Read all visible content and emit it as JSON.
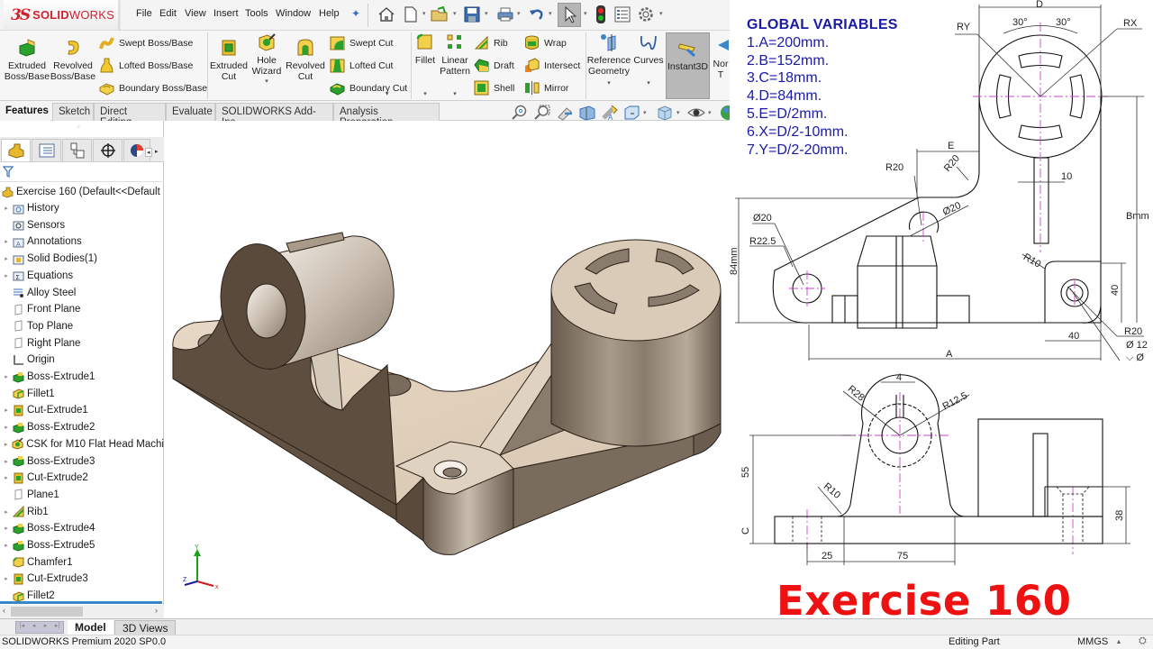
{
  "app": {
    "logo_prefix": "3S",
    "logo_bold": "SOLID",
    "logo_light": "WORKS"
  },
  "menu": [
    "File",
    "Edit",
    "View",
    "Insert",
    "Tools",
    "Window",
    "Help"
  ],
  "quick_access": [
    "home-icon",
    "new-document-icon",
    "open-icon",
    "save-icon",
    "print-icon",
    "undo-icon",
    "select-icon",
    "rebuild-icon",
    "file-properties-icon",
    "options-icon"
  ],
  "ribbon": {
    "extruded_boss": "Extruded\nBoss/Base",
    "revolved_boss": "Revolved\nBoss/Base",
    "swept_boss": "Swept Boss/Base",
    "lofted_boss": "Lofted Boss/Base",
    "boundary_boss": "Boundary Boss/Base",
    "extruded_cut": "Extruded\nCut",
    "hole_wizard": "Hole\nWizard",
    "revolved_cut": "Revolved\nCut",
    "swept_cut": "Swept Cut",
    "lofted_cut": "Lofted Cut",
    "boundary_cut": "Boundary Cut",
    "fillet": "Fillet",
    "linear_pattern": "Linear\nPattern",
    "rib": "Rib",
    "draft": "Draft",
    "shell": "Shell",
    "wrap": "Wrap",
    "intersect": "Intersect",
    "mirror": "Mirror",
    "reference_geometry": "Reference\nGeometry",
    "curves": "Curves",
    "instant3d": "Instant3D",
    "normal_to": "Nor\nT"
  },
  "command_tabs": [
    "Features",
    "Sketch",
    "Direct Editing",
    "Evaluate",
    "SOLIDWORKS Add-Ins",
    "Analysis Preparation"
  ],
  "active_command_tab": "Features",
  "feature_tree": {
    "root": "Exercise 160  (Default<<Default",
    "items": [
      {
        "label": "History",
        "icon": "history-folder-icon",
        "expandable": true
      },
      {
        "label": "Sensors",
        "icon": "sensors-folder-icon",
        "expandable": false
      },
      {
        "label": "Annotations",
        "icon": "annotations-folder-icon",
        "expandable": true
      },
      {
        "label": "Solid Bodies(1)",
        "icon": "solid-bodies-folder-icon",
        "expandable": true
      },
      {
        "label": "Equations",
        "icon": "equations-folder-icon",
        "expandable": true
      },
      {
        "label": "Alloy Steel",
        "icon": "material-icon",
        "expandable": false
      },
      {
        "label": "Front Plane",
        "icon": "plane-icon",
        "expandable": false
      },
      {
        "label": "Top Plane",
        "icon": "plane-icon",
        "expandable": false
      },
      {
        "label": "Right Plane",
        "icon": "plane-icon",
        "expandable": false
      },
      {
        "label": "Origin",
        "icon": "origin-icon",
        "expandable": false
      },
      {
        "label": "Boss-Extrude1",
        "icon": "boss-extrude-icon",
        "expandable": true
      },
      {
        "label": "Fillet1",
        "icon": "fillet-icon",
        "expandable": false
      },
      {
        "label": "Cut-Extrude1",
        "icon": "cut-extrude-icon",
        "expandable": true
      },
      {
        "label": "Boss-Extrude2",
        "icon": "boss-extrude-icon",
        "expandable": true
      },
      {
        "label": "CSK for M10 Flat Head Machi",
        "icon": "hole-wizard-icon",
        "expandable": true
      },
      {
        "label": "Boss-Extrude3",
        "icon": "boss-extrude-icon",
        "expandable": true
      },
      {
        "label": "Cut-Extrude2",
        "icon": "cut-extrude-icon",
        "expandable": true
      },
      {
        "label": "Plane1",
        "icon": "plane-icon",
        "expandable": false
      },
      {
        "label": "Rib1",
        "icon": "rib-icon",
        "expandable": true
      },
      {
        "label": "Boss-Extrude4",
        "icon": "boss-extrude-icon",
        "expandable": true
      },
      {
        "label": "Boss-Extrude5",
        "icon": "boss-extrude-icon",
        "expandable": true
      },
      {
        "label": "Chamfer1",
        "icon": "chamfer-icon",
        "expandable": false
      },
      {
        "label": "Cut-Extrude3",
        "icon": "cut-extrude-icon",
        "expandable": true
      },
      {
        "label": "Fillet2",
        "icon": "fillet-icon",
        "expandable": false
      }
    ]
  },
  "global_variables": {
    "title": "GLOBAL VARIABLES",
    "lines": [
      "1.A=200mm.",
      "2.B=152mm.",
      "3.C=18mm.",
      "4.D=84mm.",
      "5.E=D/2mm.",
      "6.X=D/2-10mm.",
      "7.Y=D/2-20mm."
    ]
  },
  "drawing_dims": {
    "top": {
      "D": "D",
      "RY": "RY",
      "RX": "RX",
      "angle1": "30°",
      "angle2": "30°",
      "E": "E",
      "R20a": "R20",
      "R20b": "R20",
      "w10": "10",
      "B": "Bmm",
      "d20a": "Ø20",
      "R22_5": "R22.5",
      "h84": "84mm",
      "d20b": "Ø20",
      "R10": "R10",
      "h40": "40",
      "w40": "40",
      "R20c": "R20",
      "d12": "Ø 12",
      "csk": "⌵ Ø",
      "A": "A"
    },
    "front": {
      "w4": "4",
      "R28": "R28",
      "R12_5": "R12.5",
      "h55": "55",
      "R10": "R10",
      "C": "C",
      "w25": "25",
      "w75": "75",
      "h38": "38"
    }
  },
  "exercise_title": "Exercise 160",
  "triad": {
    "x": "x",
    "y": "Y",
    "z": "Z"
  },
  "bottom_tabs": [
    "Model",
    "3D Views"
  ],
  "active_bottom_tab": "Model",
  "status": {
    "version": "SOLIDWORKS Premium 2020 SP0.0",
    "mode": "Editing Part",
    "units": "MMGS",
    "units_arrow": "▴"
  },
  "colors": {
    "brand_red": "#d21f2d",
    "variables_blue": "#1a1aa8",
    "exercise_red": "#ee1111",
    "centerline_magenta": "#cc44cc"
  }
}
